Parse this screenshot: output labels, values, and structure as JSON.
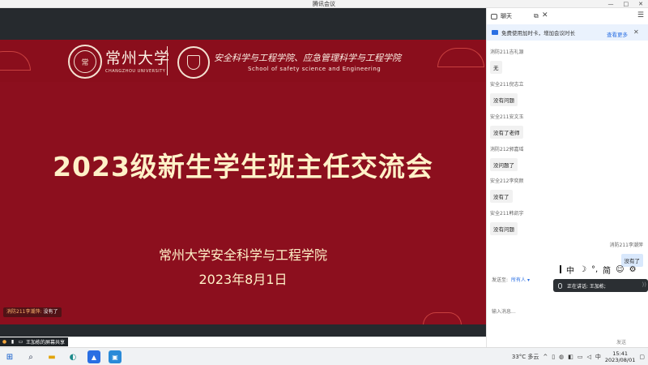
{
  "window": {
    "title": "腾讯会议",
    "controls": [
      "—",
      "□",
      "✕"
    ]
  },
  "slide": {
    "university_cn": "常州大学",
    "university_en": "CHANGZHOU UNIVERSITY",
    "school_cn": "安全科学与工程学院、应急管理科学与工程学院",
    "school_en": "School of safety science and Engineering",
    "title": "2023级新生学生班主任交流会",
    "subtitle": "常州大学安全科学与工程学院",
    "date": "2023年8月1日",
    "speaking_tag_name": "消防211李潮萍:",
    "speaking_tag_text": "没有了"
  },
  "share_bar": {
    "label": "王加栋的屏幕共享"
  },
  "chat": {
    "header": "聊天",
    "notice": {
      "text": "免费使用加时卡，增加会议时长",
      "link": "查看更多"
    },
    "messages": [
      {
        "sender": "消防211吉礼源",
        "text": "无"
      },
      {
        "sender": "安全211倪志立",
        "text": "没有问题"
      },
      {
        "sender": "安全211安文玉",
        "text": "没有了老师"
      },
      {
        "sender": "消防212郭嘉瑶",
        "text": "没问题了"
      },
      {
        "sender": "安全212李奕颜",
        "text": "没有了"
      },
      {
        "sender": "安全211韩凯宇",
        "text": "没有问题"
      }
    ],
    "my_message": {
      "sender": "消防211李潮萍",
      "text": "没有了"
    },
    "ime": {
      "mode": "中",
      "moon": "☽",
      "punct": "°,",
      "simplified": "简",
      "emoji": "☺",
      "settings": "⚙"
    },
    "send_to_label": "发送至:",
    "send_to_value": "所有人 ▾",
    "input_placeholder": "输入消息...",
    "send_label": "发送",
    "speaking_now": "正在讲话: 王加栋;",
    "speaking_tail": "))"
  },
  "taskbar": {
    "weather": "33°C 多云",
    "tray_caret": "^",
    "ime_lang": "中",
    "time": "15:41",
    "date": "2023/08/01",
    "icons": [
      "windows-start",
      "search",
      "file-explorer",
      "edge",
      "tencent-meeting",
      "app"
    ]
  }
}
